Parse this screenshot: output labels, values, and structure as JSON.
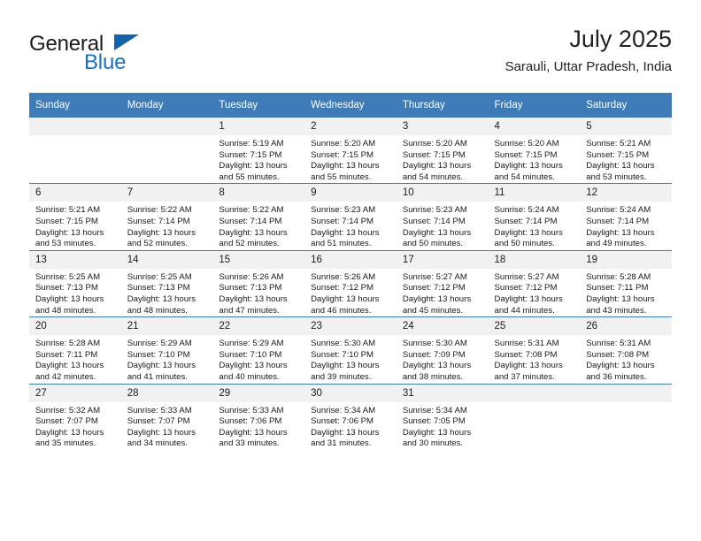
{
  "logo": {
    "word1": "General",
    "word2": "Blue",
    "triangle_color": "#1263ad",
    "word2_color": "#1774c4"
  },
  "header": {
    "title": "July 2025",
    "subtitle": "Sarauli, Uttar Pradesh, India"
  },
  "theme": {
    "header_blue": "#3d7cb8",
    "daynum_bg": "#f1f1f1",
    "text": "#1a1a1a"
  },
  "weekdays": [
    "Sunday",
    "Monday",
    "Tuesday",
    "Wednesday",
    "Thursday",
    "Friday",
    "Saturday"
  ],
  "weeks": [
    [
      {
        "day": "",
        "lines": []
      },
      {
        "day": "",
        "lines": []
      },
      {
        "day": "1",
        "lines": [
          "Sunrise: 5:19 AM",
          "Sunset: 7:15 PM",
          "Daylight: 13 hours and 55 minutes."
        ]
      },
      {
        "day": "2",
        "lines": [
          "Sunrise: 5:20 AM",
          "Sunset: 7:15 PM",
          "Daylight: 13 hours and 55 minutes."
        ]
      },
      {
        "day": "3",
        "lines": [
          "Sunrise: 5:20 AM",
          "Sunset: 7:15 PM",
          "Daylight: 13 hours and 54 minutes."
        ]
      },
      {
        "day": "4",
        "lines": [
          "Sunrise: 5:20 AM",
          "Sunset: 7:15 PM",
          "Daylight: 13 hours and 54 minutes."
        ]
      },
      {
        "day": "5",
        "lines": [
          "Sunrise: 5:21 AM",
          "Sunset: 7:15 PM",
          "Daylight: 13 hours and 53 minutes."
        ]
      }
    ],
    [
      {
        "day": "6",
        "lines": [
          "Sunrise: 5:21 AM",
          "Sunset: 7:15 PM",
          "Daylight: 13 hours and 53 minutes."
        ]
      },
      {
        "day": "7",
        "lines": [
          "Sunrise: 5:22 AM",
          "Sunset: 7:14 PM",
          "Daylight: 13 hours and 52 minutes."
        ]
      },
      {
        "day": "8",
        "lines": [
          "Sunrise: 5:22 AM",
          "Sunset: 7:14 PM",
          "Daylight: 13 hours and 52 minutes."
        ]
      },
      {
        "day": "9",
        "lines": [
          "Sunrise: 5:23 AM",
          "Sunset: 7:14 PM",
          "Daylight: 13 hours and 51 minutes."
        ]
      },
      {
        "day": "10",
        "lines": [
          "Sunrise: 5:23 AM",
          "Sunset: 7:14 PM",
          "Daylight: 13 hours and 50 minutes."
        ]
      },
      {
        "day": "11",
        "lines": [
          "Sunrise: 5:24 AM",
          "Sunset: 7:14 PM",
          "Daylight: 13 hours and 50 minutes."
        ]
      },
      {
        "day": "12",
        "lines": [
          "Sunrise: 5:24 AM",
          "Sunset: 7:14 PM",
          "Daylight: 13 hours and 49 minutes."
        ]
      }
    ],
    [
      {
        "day": "13",
        "lines": [
          "Sunrise: 5:25 AM",
          "Sunset: 7:13 PM",
          "Daylight: 13 hours and 48 minutes."
        ]
      },
      {
        "day": "14",
        "lines": [
          "Sunrise: 5:25 AM",
          "Sunset: 7:13 PM",
          "Daylight: 13 hours and 48 minutes."
        ]
      },
      {
        "day": "15",
        "lines": [
          "Sunrise: 5:26 AM",
          "Sunset: 7:13 PM",
          "Daylight: 13 hours and 47 minutes."
        ]
      },
      {
        "day": "16",
        "lines": [
          "Sunrise: 5:26 AM",
          "Sunset: 7:12 PM",
          "Daylight: 13 hours and 46 minutes."
        ]
      },
      {
        "day": "17",
        "lines": [
          "Sunrise: 5:27 AM",
          "Sunset: 7:12 PM",
          "Daylight: 13 hours and 45 minutes."
        ]
      },
      {
        "day": "18",
        "lines": [
          "Sunrise: 5:27 AM",
          "Sunset: 7:12 PM",
          "Daylight: 13 hours and 44 minutes."
        ]
      },
      {
        "day": "19",
        "lines": [
          "Sunrise: 5:28 AM",
          "Sunset: 7:11 PM",
          "Daylight: 13 hours and 43 minutes."
        ]
      }
    ],
    [
      {
        "day": "20",
        "lines": [
          "Sunrise: 5:28 AM",
          "Sunset: 7:11 PM",
          "Daylight: 13 hours and 42 minutes."
        ]
      },
      {
        "day": "21",
        "lines": [
          "Sunrise: 5:29 AM",
          "Sunset: 7:10 PM",
          "Daylight: 13 hours and 41 minutes."
        ]
      },
      {
        "day": "22",
        "lines": [
          "Sunrise: 5:29 AM",
          "Sunset: 7:10 PM",
          "Daylight: 13 hours and 40 minutes."
        ]
      },
      {
        "day": "23",
        "lines": [
          "Sunrise: 5:30 AM",
          "Sunset: 7:10 PM",
          "Daylight: 13 hours and 39 minutes."
        ]
      },
      {
        "day": "24",
        "lines": [
          "Sunrise: 5:30 AM",
          "Sunset: 7:09 PM",
          "Daylight: 13 hours and 38 minutes."
        ]
      },
      {
        "day": "25",
        "lines": [
          "Sunrise: 5:31 AM",
          "Sunset: 7:08 PM",
          "Daylight: 13 hours and 37 minutes."
        ]
      },
      {
        "day": "26",
        "lines": [
          "Sunrise: 5:31 AM",
          "Sunset: 7:08 PM",
          "Daylight: 13 hours and 36 minutes."
        ]
      }
    ],
    [
      {
        "day": "27",
        "lines": [
          "Sunrise: 5:32 AM",
          "Sunset: 7:07 PM",
          "Daylight: 13 hours and 35 minutes."
        ]
      },
      {
        "day": "28",
        "lines": [
          "Sunrise: 5:33 AM",
          "Sunset: 7:07 PM",
          "Daylight: 13 hours and 34 minutes."
        ]
      },
      {
        "day": "29",
        "lines": [
          "Sunrise: 5:33 AM",
          "Sunset: 7:06 PM",
          "Daylight: 13 hours and 33 minutes."
        ]
      },
      {
        "day": "30",
        "lines": [
          "Sunrise: 5:34 AM",
          "Sunset: 7:06 PM",
          "Daylight: 13 hours and 31 minutes."
        ]
      },
      {
        "day": "31",
        "lines": [
          "Sunrise: 5:34 AM",
          "Sunset: 7:05 PM",
          "Daylight: 13 hours and 30 minutes."
        ]
      },
      {
        "day": "",
        "lines": []
      },
      {
        "day": "",
        "lines": []
      }
    ]
  ]
}
